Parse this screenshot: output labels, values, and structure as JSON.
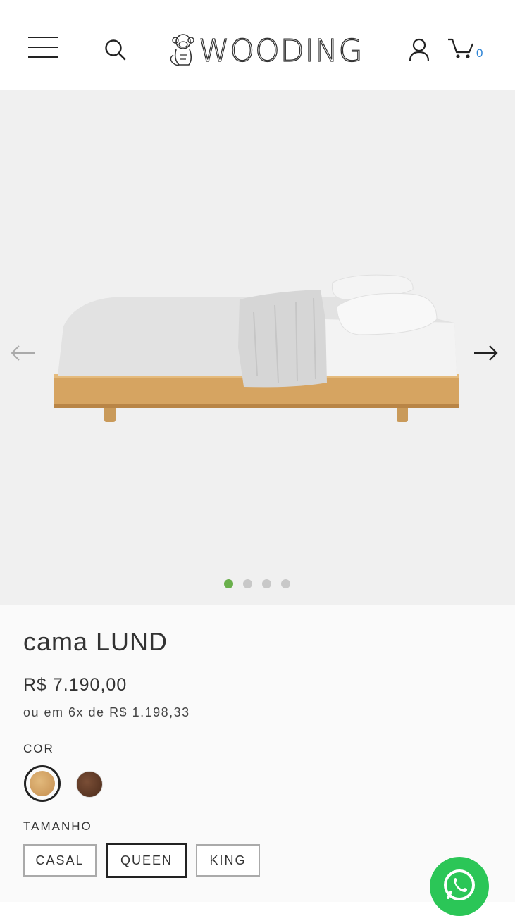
{
  "header": {
    "logo_text": "WOODING",
    "cart_count": "0"
  },
  "gallery": {
    "slide_count": 4,
    "active_slide": 1,
    "active_color": "#6ab04c"
  },
  "product": {
    "title": "cama LUND",
    "price": "R$ 7.190,00",
    "installments": "ou em 6x de R$ 1.198,33"
  },
  "options": {
    "color_label": "COR",
    "colors": [
      {
        "name": "light-oak-swatch",
        "hex": "#d4a363",
        "selected": true
      },
      {
        "name": "walnut-swatch",
        "hex": "#5c3724",
        "selected": false
      }
    ],
    "size_label": "TAMANHO",
    "sizes": [
      {
        "label": "CASAL",
        "selected": false
      },
      {
        "label": "QUEEN",
        "selected": true
      },
      {
        "label": "KING",
        "selected": false
      }
    ]
  },
  "colors": {
    "whatsapp": "#2bc657",
    "cart_count": "#2f85d6"
  }
}
